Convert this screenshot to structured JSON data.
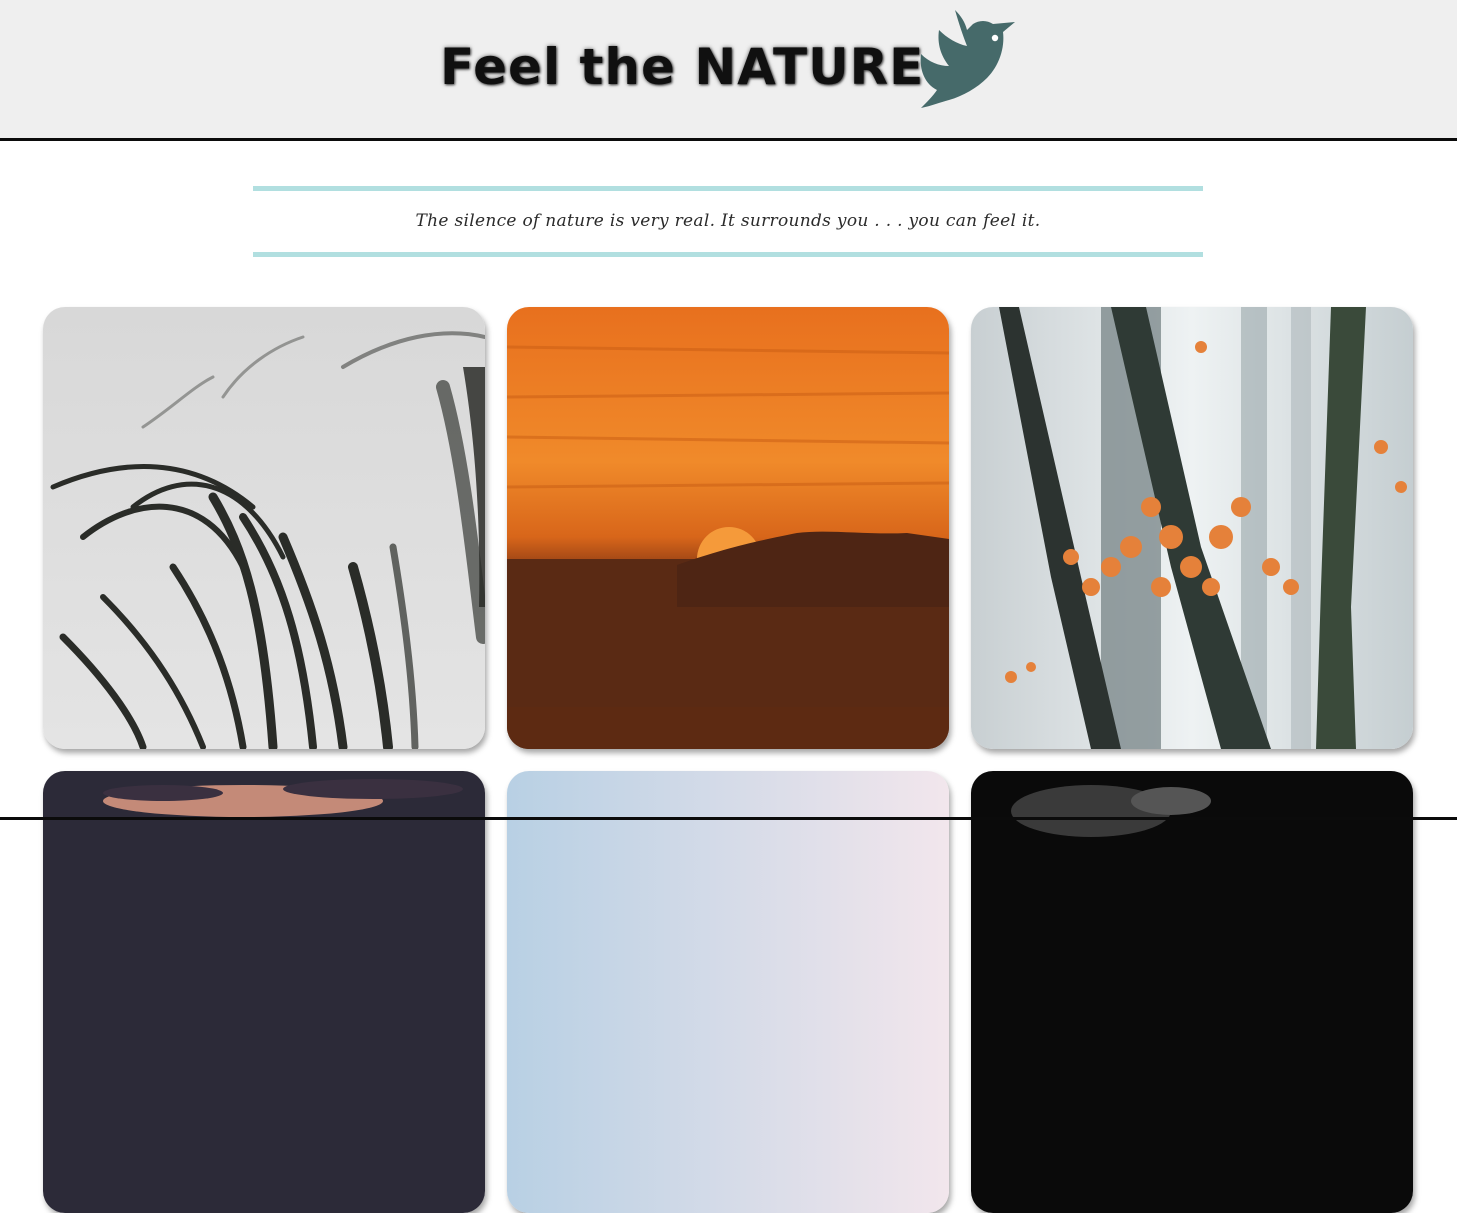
{
  "header": {
    "title": "Feel the NATURE",
    "logo_icon": "bird-icon",
    "background_color": "#efefef",
    "logo_color": "#466a6a"
  },
  "quote": {
    "text": "The silence of nature is very real. It surrounds you . . . you can feel it.",
    "border_color": "#b1dfe0"
  },
  "gallery": {
    "images": [
      {
        "subject": "grass-silhouette"
      },
      {
        "subject": "orange-sunset"
      },
      {
        "subject": "foggy-forest-orange-leaves"
      },
      {
        "subject": "dusk-clouds"
      },
      {
        "subject": "pale-sky"
      },
      {
        "subject": "dark-clouds"
      }
    ]
  }
}
